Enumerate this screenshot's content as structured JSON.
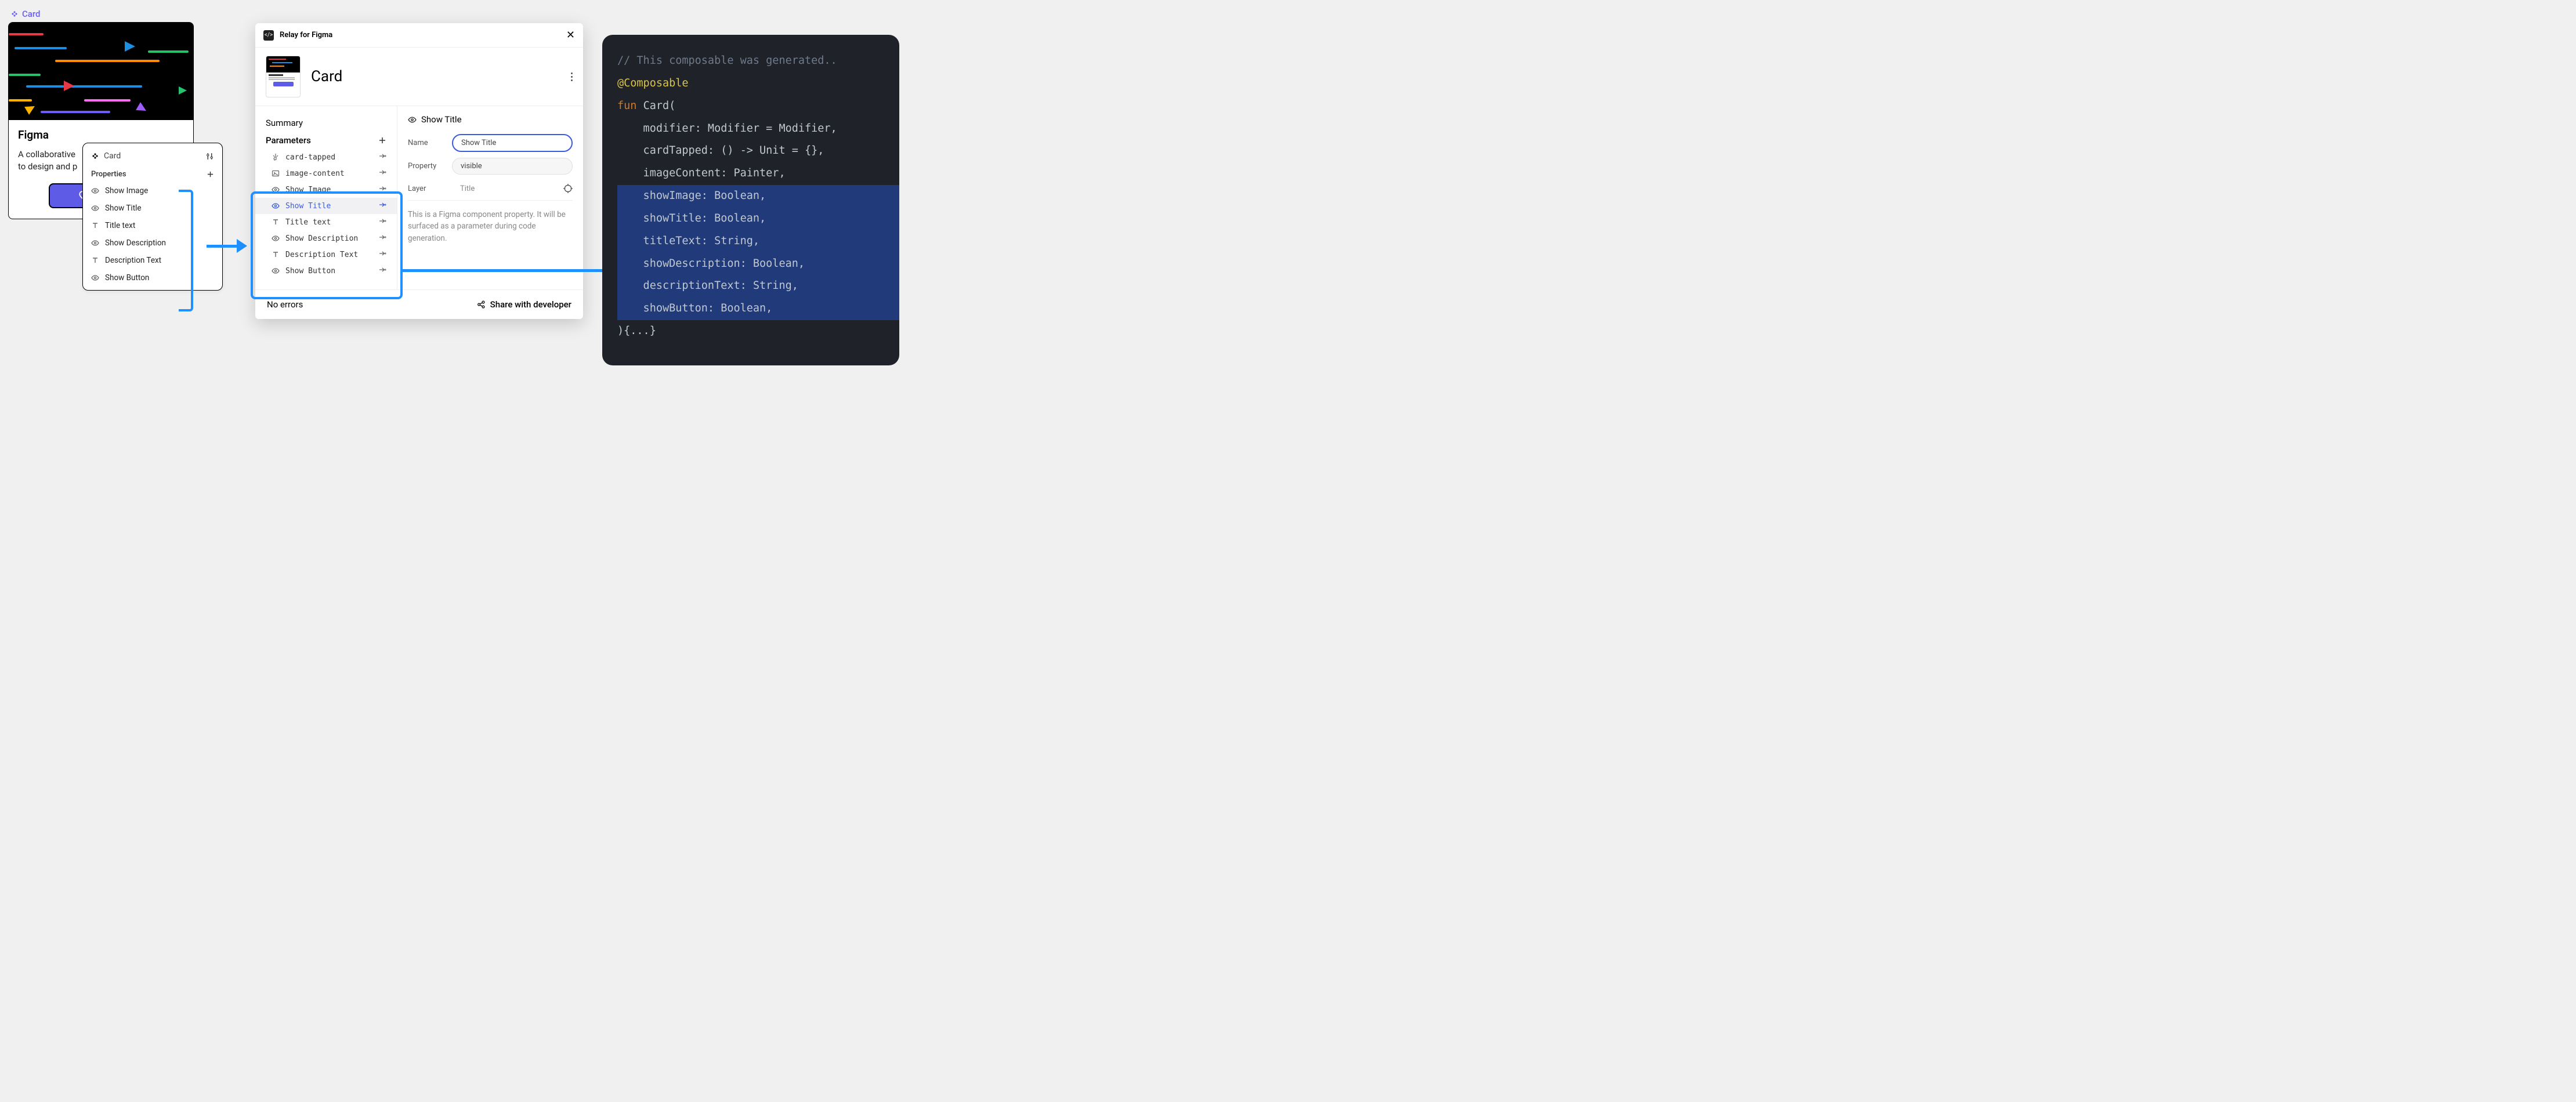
{
  "component_label": "Card",
  "figma_card": {
    "title": "Figma",
    "description_line1": "A collaborative",
    "description_line2": "to design and p",
    "button_label": "Button"
  },
  "props_panel": {
    "header": "Card",
    "section": "Properties",
    "items": [
      {
        "icon": "eye",
        "label": "Show Image"
      },
      {
        "icon": "eye",
        "label": "Show Title"
      },
      {
        "icon": "text",
        "label": "Title text"
      },
      {
        "icon": "eye",
        "label": "Show Description"
      },
      {
        "icon": "text",
        "label": "Description Text"
      },
      {
        "icon": "eye",
        "label": "Show Button"
      }
    ]
  },
  "relay": {
    "app_title": "Relay for Figma",
    "card_title": "Card",
    "summary_label": "Summary",
    "parameters_label": "Parameters",
    "params": [
      {
        "icon": "tap",
        "label": "card-tapped",
        "selected": false
      },
      {
        "icon": "image",
        "label": "image-content",
        "selected": false
      },
      {
        "icon": "eye",
        "label": "Show Image",
        "selected": false
      },
      {
        "icon": "eye",
        "label": "Show Title",
        "selected": true
      },
      {
        "icon": "text",
        "label": "Title text",
        "selected": false
      },
      {
        "icon": "eye",
        "label": "Show Description",
        "selected": false
      },
      {
        "icon": "text",
        "label": "Description Text",
        "selected": false
      },
      {
        "icon": "eye",
        "label": "Show Button",
        "selected": false
      }
    ],
    "detail": {
      "heading": "Show Title",
      "name_label": "Name",
      "name_value": "Show Title",
      "property_label": "Property",
      "property_value": "visible",
      "layer_label": "Layer",
      "layer_value": "Title",
      "info": "This is a Figma component property. It will be surfaced as a parameter during code generation."
    },
    "footer": {
      "errors": "No errors",
      "share": "Share with developer"
    }
  },
  "code": {
    "lines": [
      {
        "cls": "cm",
        "text": "// This composable was generated.."
      },
      {
        "cls": "an",
        "text": "@Composable"
      },
      {
        "cls": "",
        "html": "<span class='kw'>fun </span><span class='fn'>Card</span>("
      },
      {
        "cls": "",
        "text": "    modifier: Modifier = Modifier,"
      },
      {
        "cls": "",
        "text": "    cardTapped: () -> Unit = {},"
      },
      {
        "cls": "",
        "text": "    imageContent: Painter,"
      },
      {
        "cls": "hl",
        "text": "    showImage: Boolean,"
      },
      {
        "cls": "hl",
        "text": "    showTitle: Boolean,"
      },
      {
        "cls": "hl",
        "text": "    titleText: String,"
      },
      {
        "cls": "hl",
        "text": "    showDescription: Boolean,"
      },
      {
        "cls": "hl",
        "text": "    descriptionText: String,"
      },
      {
        "cls": "hl",
        "text": "    showButton: Boolean,"
      },
      {
        "cls": "",
        "text": "){...}"
      }
    ]
  }
}
